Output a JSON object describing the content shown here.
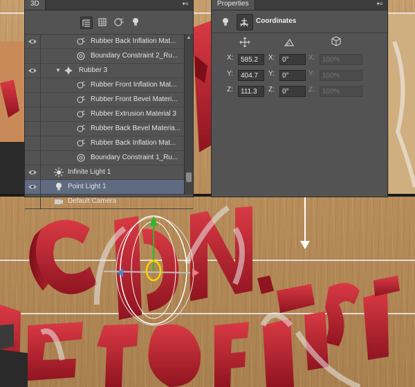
{
  "panel_3d": {
    "tab_label": "3D",
    "menu_icon": "panel-menu-icon",
    "filters": [
      "scene-filter-icon",
      "mesh-filter-icon",
      "material-filter-icon",
      "light-filter-icon"
    ],
    "layers": [
      {
        "label": "Rubber Back Inflation Mat...",
        "icon": "material-icon",
        "indent": 2,
        "eye": true,
        "selected": false
      },
      {
        "label": "Boundary Constraint 2_Ru...",
        "icon": "constraint-icon",
        "indent": 2,
        "eye": false,
        "selected": false
      },
      {
        "label": "Rubber 3",
        "icon": "mesh-icon",
        "indent": 1,
        "eye": true,
        "selected": false,
        "expanded": true
      },
      {
        "label": "Rubber Front Inflation Mat...",
        "icon": "material-icon",
        "indent": 2,
        "eye": false,
        "selected": false
      },
      {
        "label": "Rubber Front Bevel Materi...",
        "icon": "material-icon",
        "indent": 2,
        "eye": false,
        "selected": false
      },
      {
        "label": "Rubber Extrusion Material 3",
        "icon": "material-icon",
        "indent": 2,
        "eye": false,
        "selected": false
      },
      {
        "label": "Rubber Back Bevel Materia...",
        "icon": "material-icon",
        "indent": 2,
        "eye": false,
        "selected": false
      },
      {
        "label": "Rubber Back Inflation Mat...",
        "icon": "material-icon",
        "indent": 2,
        "eye": false,
        "selected": false
      },
      {
        "label": "Boundary Constraint 1_Ru...",
        "icon": "constraint-icon",
        "indent": 2,
        "eye": false,
        "selected": false
      },
      {
        "label": "Infinite Light 1",
        "icon": "infinite-light-icon",
        "indent": 0,
        "eye": true,
        "selected": false
      },
      {
        "label": "Point Light 1",
        "icon": "point-light-icon",
        "indent": 0,
        "eye": true,
        "selected": true
      },
      {
        "label": "Default Camera",
        "icon": "camera-icon",
        "indent": 0,
        "eye": false,
        "selected": false
      }
    ]
  },
  "properties": {
    "tab_label": "Properties",
    "section_title": "Coordinates",
    "header_icons": [
      "point-light-icon",
      "coordinates-icon"
    ],
    "column_icons": [
      "move-icon",
      "rotate-icon",
      "scale-icon"
    ],
    "rows": [
      {
        "axis": "X:",
        "position": "585.2",
        "rot_axis": "X:",
        "rotation": "0°",
        "scale_axis": "X:",
        "scale": "100%"
      },
      {
        "axis": "Y:",
        "position": "404.7",
        "rot_axis": "Y:",
        "rotation": "0°",
        "scale_axis": "Y:",
        "scale": "100%"
      },
      {
        "axis": "Z:",
        "position": "111.3",
        "rot_axis": "Z:",
        "rotation": "0°",
        "scale_axis": "Z:",
        "scale": "100%"
      }
    ]
  },
  "canvas": {
    "background": "wood",
    "accent_red": "#b3202c",
    "gizmo_colors": {
      "y_axis": "#2eb82e",
      "x_axis": "#e88080",
      "z_axis": "#3a8fd6",
      "ring": "#ffd400"
    }
  }
}
